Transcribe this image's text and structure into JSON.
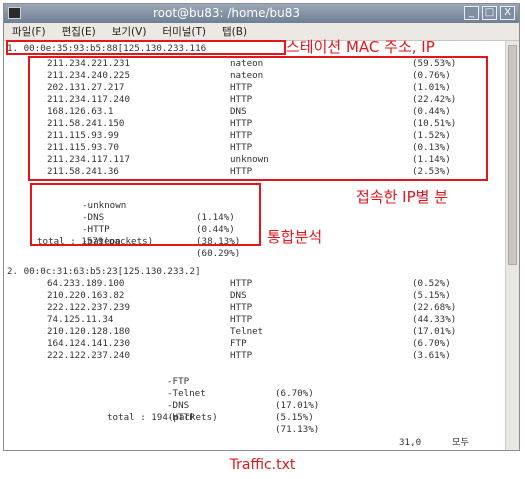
{
  "window": {
    "title": "root@bu83: /home/bu83",
    "controls": [
      "_",
      "□",
      "X"
    ]
  },
  "menubar": [
    "파일(F)",
    "편집(E)",
    "보기(V)",
    "터미널(T)",
    "탭(B)"
  ],
  "host1": {
    "header": "1. 00:0e:35:93:b5:88[125.130.233.116",
    "rows": [
      {
        "ip": "211.234.221.231",
        "proto": "nateon",
        "pct": "(59.53%)"
      },
      {
        "ip": "211.234.240.225",
        "proto": "nateon",
        "pct": "(0.76%)"
      },
      {
        "ip": "202.131.27.217",
        "proto": "HTTP",
        "pct": "(1.01%)"
      },
      {
        "ip": "211.234.117.240",
        "proto": "HTTP",
        "pct": "(22.42%)"
      },
      {
        "ip": "168.126.63.1",
        "proto": "DNS",
        "pct": "(0.44%)"
      },
      {
        "ip": "211.58.241.150",
        "proto": "HTTP",
        "pct": "(10.51%)"
      },
      {
        "ip": "211.115.93.99",
        "proto": "HTTP",
        "pct": "(1.52%)"
      },
      {
        "ip": "211.115.93.70",
        "proto": "HTTP",
        "pct": "(0.13%)"
      },
      {
        "ip": "211.234.117.117",
        "proto": "unknown",
        "pct": "(1.14%)"
      },
      {
        "ip": "211.58.241.36",
        "proto": "HTTP",
        "pct": "(2.53%)"
      }
    ],
    "summary": [
      {
        "proto": "-unknown",
        "pct": "(1.14%)"
      },
      {
        "proto": "-DNS",
        "pct": "(0.44%)"
      },
      {
        "proto": "-HTTP",
        "pct": "(38.13%)"
      },
      {
        "proto": "-nateon",
        "pct": "(60.29%)"
      }
    ],
    "total": "total : 1579(packets)"
  },
  "host2": {
    "header": "2. 00:0c:31:63:b5:23[125.130.233.2]",
    "rows": [
      {
        "ip": "64.233.189.100",
        "proto": "HTTP",
        "pct": "(0.52%)"
      },
      {
        "ip": "210.220.163.82",
        "proto": "DNS",
        "pct": "(5.15%)"
      },
      {
        "ip": "222.122.237.239",
        "proto": "HTTP",
        "pct": "(22.68%)"
      },
      {
        "ip": "74.125.11.34",
        "proto": "HTTP",
        "pct": "(44.33%)"
      },
      {
        "ip": "210.120.128.180",
        "proto": "Telnet",
        "pct": "(17.01%)"
      },
      {
        "ip": "164.124.141.230",
        "proto": "FTP",
        "pct": "(6.70%)"
      },
      {
        "ip": "222.122.237.240",
        "proto": "HTTP",
        "pct": "(3.61%)"
      }
    ],
    "summary": [
      {
        "proto": "-FTP",
        "pct": "(6.70%)"
      },
      {
        "proto": "-Telnet",
        "pct": "(17.01%)"
      },
      {
        "proto": "-DNS",
        "pct": "(5.15%)"
      },
      {
        "proto": "-HTTP",
        "pct": "(71.13%)"
      }
    ],
    "total": "total : 194(packets)"
  },
  "status": {
    "position": "31,0",
    "mode": "모두"
  },
  "annotations": {
    "station_mac_ip": "스테이션 MAC 주소, IP",
    "per_ip": "접속한 IP별 분",
    "integrated": "통합분석",
    "caption": "Traffic.txt",
    "color": "#e4151b"
  }
}
